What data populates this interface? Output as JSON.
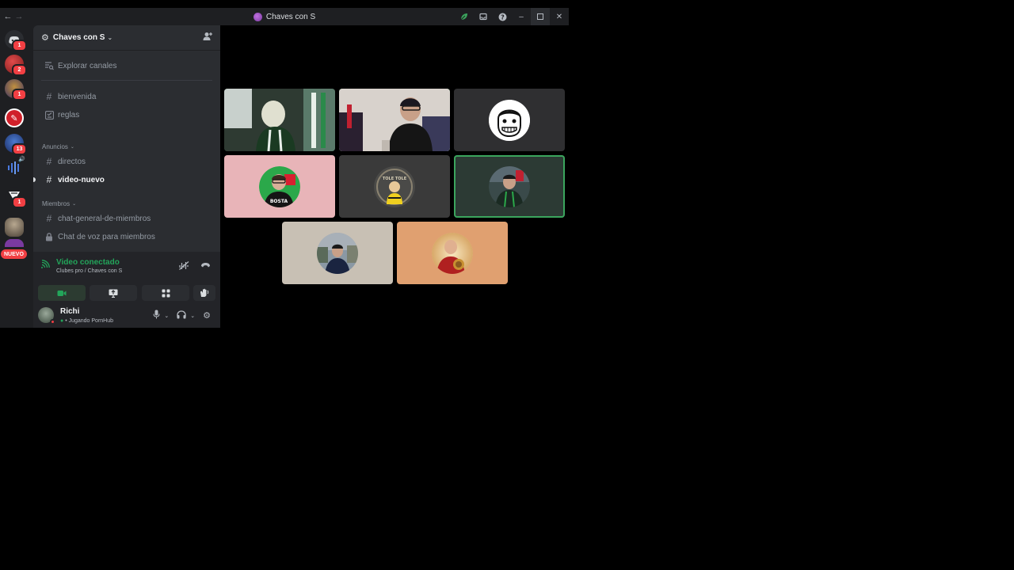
{
  "window": {
    "title": "Chaves con S"
  },
  "servers": [
    {
      "name": "discord-home",
      "badge": "1"
    },
    {
      "name": "server-2",
      "badge": "2"
    },
    {
      "name": "server-3",
      "badge": "1"
    },
    {
      "name": "server-4",
      "badge": ""
    },
    {
      "name": "server-5",
      "badge": "13"
    },
    {
      "name": "server-6",
      "badge": ""
    },
    {
      "name": "server-7",
      "badge": "1"
    },
    {
      "name": "server-8",
      "badge": ""
    }
  ],
  "new_label": "NUEVO",
  "server": {
    "name": "Chaves con S"
  },
  "channels": {
    "browse": "Explorar canales",
    "top": [
      {
        "name": "bienvenida",
        "icon": "hash"
      },
      {
        "name": "reglas",
        "icon": "rules"
      }
    ],
    "categories": [
      {
        "name": "Anuncios",
        "channels": [
          {
            "name": "directos",
            "icon": "hash"
          },
          {
            "name": "video-nuevo",
            "icon": "hash",
            "active": true
          }
        ]
      },
      {
        "name": "Miembros",
        "channels": [
          {
            "name": "chat-general-de-miembros",
            "icon": "hash"
          },
          {
            "name": "Chat de voz para miembros",
            "icon": "lock"
          }
        ]
      }
    ]
  },
  "voice": {
    "status": "Video conectado",
    "location": "Clubes pro / Chaves con S"
  },
  "user": {
    "name": "Richi",
    "activity": "• Jugando PornHub"
  },
  "colors": {
    "green": "#23a55a",
    "red": "#f23f43",
    "tile_pink": "#e8b4b8",
    "tile_dark": "#2f2f31",
    "tile_teal": "#2c3a34",
    "tile_gray": "#c8c0b4",
    "tile_orange": "#e0a070"
  }
}
